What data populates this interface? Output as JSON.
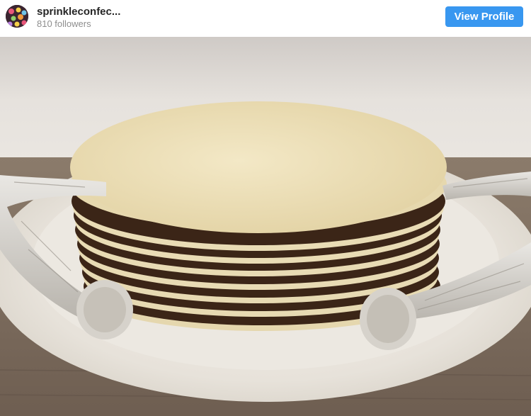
{
  "profile": {
    "username": "sprinkleconfec...",
    "followers": "810 followers",
    "avatar_icon": "sprinkles-avatar"
  },
  "actions": {
    "view_profile_label": "View Profile"
  },
  "colors": {
    "accent": "#3897f0",
    "username_text": "#262626",
    "muted_text": "#8e8e8e"
  },
  "post": {
    "subject": "stack-cake-photo"
  }
}
